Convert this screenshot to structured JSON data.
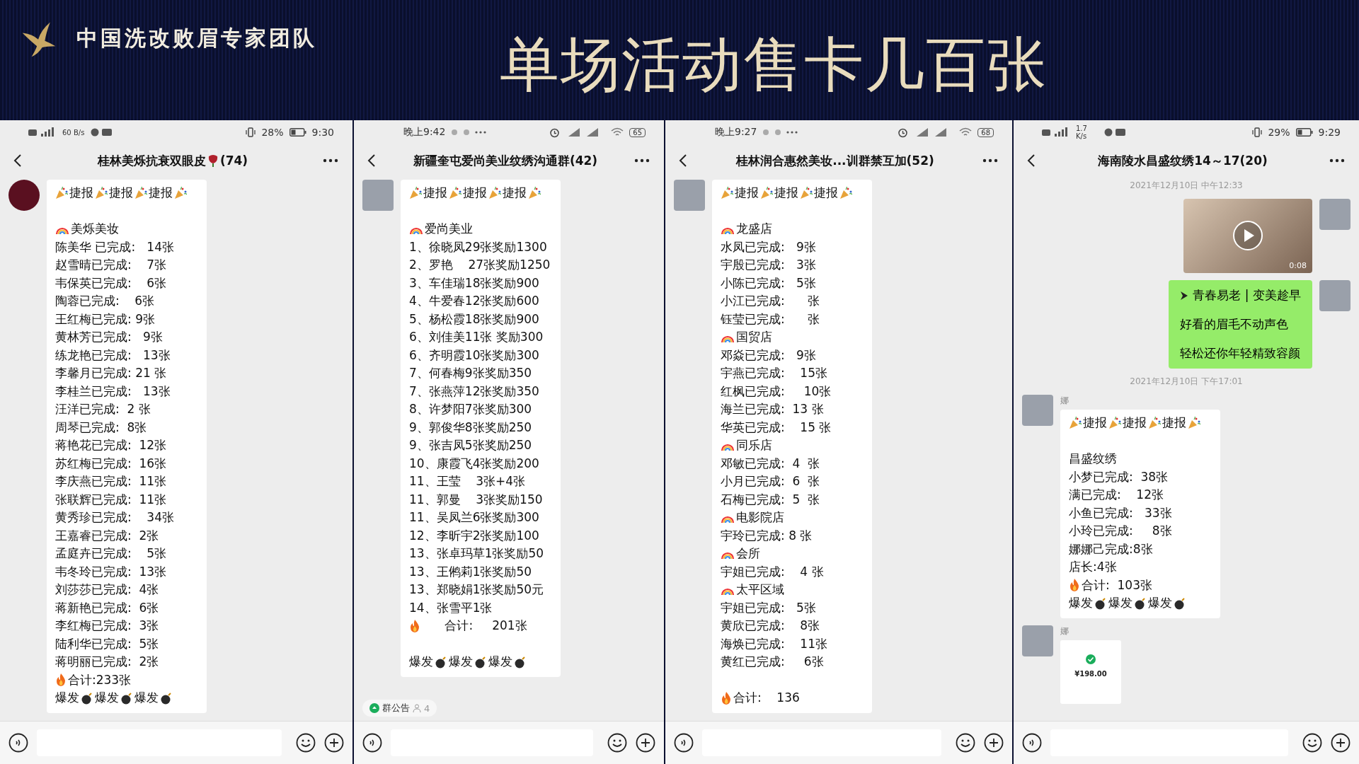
{
  "slide": {
    "team_name": "中国洗改败眉专家团队",
    "title": "单场活动售卡几百张"
  },
  "panels": [
    {
      "status": {
        "kind": "percent",
        "speed": "60 B/s",
        "battery": "28%",
        "time": "9:30"
      },
      "header": {
        "title_parts": [
          {
            "kind": "text",
            "text": "桂林美烁抗衰双眼皮"
          },
          {
            "kind": "rose"
          },
          {
            "kind": "text",
            "text": "(74)"
          }
        ]
      },
      "messages": [
        {
          "kind": "bubble",
          "lines": [
            {
              "kind": "cheer",
              "words": [
                "捷报",
                "捷报",
                "捷报"
              ]
            },
            {
              "kind": "blank"
            },
            {
              "kind": "store",
              "text": "美烁美妆"
            },
            {
              "kind": "text",
              "text": "陈美华 已完成:   14张"
            },
            {
              "kind": "text",
              "text": "赵雪晴已完成:    7张"
            },
            {
              "kind": "text",
              "text": "韦保英已完成:    6张"
            },
            {
              "kind": "text",
              "text": "陶蓉已完成:    6张"
            },
            {
              "kind": "text",
              "text": "王红梅已完成: 9张"
            },
            {
              "kind": "text",
              "text": "黄林芳已完成:   9张"
            },
            {
              "kind": "text",
              "text": "练龙艳已完成:   13张"
            },
            {
              "kind": "text",
              "text": "李馨月已完成: 21 张"
            },
            {
              "kind": "text",
              "text": "李桂兰已完成:   13张"
            },
            {
              "kind": "text",
              "text": "汪洋已完成:  2 张"
            },
            {
              "kind": "text",
              "text": "周琴已完成:  8张"
            },
            {
              "kind": "text",
              "text": "蒋艳花已完成:  12张"
            },
            {
              "kind": "text",
              "text": "苏红梅已完成:  16张"
            },
            {
              "kind": "text",
              "text": "李庆燕已完成:  11张"
            },
            {
              "kind": "text",
              "text": "张联辉已完成:  11张"
            },
            {
              "kind": "text",
              "text": "黄秀珍已完成:    34张"
            },
            {
              "kind": "text",
              "text": "王嘉睿已完成:  2张"
            },
            {
              "kind": "text",
              "text": "孟庭卉已完成:    5张"
            },
            {
              "kind": "text",
              "text": "韦冬玲已完成:  13张"
            },
            {
              "kind": "text",
              "text": "刘莎莎已完成:  4张"
            },
            {
              "kind": "text",
              "text": "蒋新艳已完成:  6张"
            },
            {
              "kind": "text",
              "text": "李红梅已完成:  3张"
            },
            {
              "kind": "text",
              "text": "陆利华已完成:  5张"
            },
            {
              "kind": "text",
              "text": "蒋明丽已完成:  2张"
            },
            {
              "kind": "total",
              "text": "合计:233张"
            },
            {
              "kind": "burst",
              "words": [
                "爆发",
                "爆发",
                "爆发"
              ]
            }
          ]
        }
      ]
    },
    {
      "status": {
        "kind": "clock_left",
        "time": "晚上9:42",
        "battery": "65"
      },
      "header": {
        "title": "新疆奎屯爱尚美业纹绣沟通群(42)"
      },
      "messages": [
        {
          "kind": "bubble",
          "lines": [
            {
              "kind": "cheer",
              "words": [
                "捷报",
                "捷报",
                "捷报"
              ]
            },
            {
              "kind": "blank"
            },
            {
              "kind": "store",
              "text": "爱尚美业"
            },
            {
              "kind": "text",
              "text": "1、徐晓凤29张奖励1300"
            },
            {
              "kind": "text",
              "text": "2、罗艳    27张奖励1250"
            },
            {
              "kind": "text",
              "text": "3、车佳瑞18张奖励900"
            },
            {
              "kind": "text",
              "text": "4、牛爱春12张奖励600"
            },
            {
              "kind": "text",
              "text": "5、杨松霞18张奖励900"
            },
            {
              "kind": "text",
              "text": "6、刘佳美11张 奖励300"
            },
            {
              "kind": "text",
              "text": "6、齐明霞10张奖励300"
            },
            {
              "kind": "text",
              "text": "7、何春梅9张奖励350"
            },
            {
              "kind": "text",
              "text": "7、张燕萍12张奖励350"
            },
            {
              "kind": "text",
              "text": "8、许梦阳7张奖励300"
            },
            {
              "kind": "text",
              "text": "9、郭俊华8张奖励250"
            },
            {
              "kind": "text",
              "text": "9、张吉凤5张奖励250"
            },
            {
              "kind": "text",
              "text": "10、康霞飞4张奖励200"
            },
            {
              "kind": "text",
              "text": "11、王莹    3张+4张"
            },
            {
              "kind": "text",
              "text": "11、郭曼    3张奖励150"
            },
            {
              "kind": "text",
              "text": "11、吴凤兰6张奖励300"
            },
            {
              "kind": "text",
              "text": "12、李昕宇2张奖励100"
            },
            {
              "kind": "text",
              "text": "13、张卓玛草1张奖励50"
            },
            {
              "kind": "text",
              "text": "13、王鸺莉1张奖励50"
            },
            {
              "kind": "text",
              "text": "13、郑晓娟1张奖励50元"
            },
            {
              "kind": "text",
              "text": "14、张雪平1张"
            },
            {
              "kind": "total",
              "text": "      合计:     201张"
            },
            {
              "kind": "blank"
            },
            {
              "kind": "burst",
              "words": [
                "爆发",
                "爆发",
                "爆发"
              ]
            }
          ]
        }
      ],
      "notice": {
        "label": "群公告",
        "count": "4"
      }
    },
    {
      "status": {
        "kind": "clock_left",
        "time": "晚上9:27",
        "battery": "68"
      },
      "header": {
        "title": "桂林润合惠然美妆...训群禁互加(52)"
      },
      "messages": [
        {
          "kind": "bubble",
          "lines": [
            {
              "kind": "cheer",
              "words": [
                "捷报",
                "捷报",
                "捷报"
              ]
            },
            {
              "kind": "blank"
            },
            {
              "kind": "store",
              "text": "龙盛店"
            },
            {
              "kind": "text",
              "text": "水凤已完成:   9张"
            },
            {
              "kind": "text",
              "text": "宇殷已完成:   3张"
            },
            {
              "kind": "text",
              "text": "小陈已完成:   5张"
            },
            {
              "kind": "text",
              "text": "小江已完成:      张"
            },
            {
              "kind": "text",
              "text": "钰莹已完成:      张"
            },
            {
              "kind": "store",
              "text": "国贸店"
            },
            {
              "kind": "text",
              "text": "邓焱已完成:   9张"
            },
            {
              "kind": "text",
              "text": "宇燕已完成:    15张"
            },
            {
              "kind": "text",
              "text": "红枫已完成:     10张"
            },
            {
              "kind": "text",
              "text": "海兰已完成:  13 张"
            },
            {
              "kind": "text",
              "text": "华英已完成:    15 张"
            },
            {
              "kind": "store",
              "text": "同乐店"
            },
            {
              "kind": "text",
              "text": "邓敏已完成:  4  张"
            },
            {
              "kind": "text",
              "text": "小月已完成:  6  张"
            },
            {
              "kind": "text",
              "text": "石梅已完成:  5  张"
            },
            {
              "kind": "store",
              "text": "电影院店"
            },
            {
              "kind": "text",
              "text": "宇玲已完成: 8 张"
            },
            {
              "kind": "store",
              "text": "会所"
            },
            {
              "kind": "text",
              "text": "宇姐已完成:    4 张"
            },
            {
              "kind": "store",
              "text": "太平区域"
            },
            {
              "kind": "text",
              "text": "宇姐已完成:   5张"
            },
            {
              "kind": "text",
              "text": "黄欣已完成:    8张"
            },
            {
              "kind": "text",
              "text": "海焕已完成:    11张"
            },
            {
              "kind": "text",
              "text": "黄红已完成:     6张"
            },
            {
              "kind": "blank"
            },
            {
              "kind": "total",
              "text": "合计:    136"
            }
          ]
        }
      ]
    },
    {
      "status": {
        "kind": "percent",
        "speed": "1.7 K/s",
        "battery": "29%",
        "time": "9:29"
      },
      "header": {
        "title": "海南陵水昌盛纹绣14～17(20)"
      },
      "messages": [
        {
          "kind": "timestamp",
          "text": "2021年12月10日 中午12:33"
        },
        {
          "kind": "video",
          "duration": "0:08"
        },
        {
          "kind": "outgoing_text",
          "lines": [
            {
              "kind": "bullet",
              "text": "青春易老 | 变美趁早"
            },
            {
              "kind": "text",
              "text": "好看的眉毛不动声色"
            },
            {
              "kind": "text",
              "text": "轻松还你年轻精致容颜"
            }
          ]
        },
        {
          "kind": "timestamp",
          "text": "2021年12月10日 下午17:01"
        },
        {
          "kind": "bubble",
          "sender": "娜",
          "lines": [
            {
              "kind": "cheer",
              "words": [
                "捷报",
                "捷报",
                "捷报"
              ]
            },
            {
              "kind": "blank"
            },
            {
              "kind": "text",
              "text": "昌盛纹绣"
            },
            {
              "kind": "text",
              "text": "小梦已完成:  38张"
            },
            {
              "kind": "text",
              "text": "满已完成:    12张"
            },
            {
              "kind": "text",
              "text": "小鱼已完成:   33张"
            },
            {
              "kind": "text",
              "text": "小玲已完成:     8张"
            },
            {
              "kind": "text",
              "text": "娜娜己完成:8张"
            },
            {
              "kind": "text",
              "text": "店长:4张"
            },
            {
              "kind": "total",
              "text": "合计:  103张"
            },
            {
              "kind": "burst",
              "words": [
                "爆发",
                "爆发",
                "爆发"
              ]
            }
          ]
        },
        {
          "kind": "image",
          "sender": "娜",
          "amount": "¥198.00"
        }
      ]
    }
  ]
}
